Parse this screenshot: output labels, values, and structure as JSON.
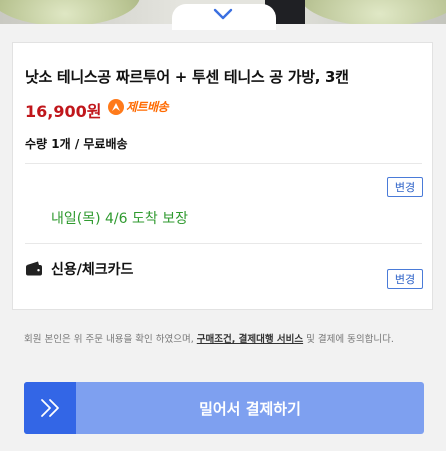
{
  "product": {
    "title": "낫소 테니스공 짜르투어 + 투센 테니스 공 가방, 3캔",
    "price": "16,900원",
    "rocket_label": "제트배송",
    "quantity_shipping": "수량 1개 / 무료배송"
  },
  "delivery": {
    "change_label": "변경",
    "arrival_text": "내일(목) 4/6 도착 보장"
  },
  "payment": {
    "method": "신용/체크카드",
    "change_label": "변경"
  },
  "notice": {
    "prefix": "회원 본인은 위 주문 내용을 확인 하였으며, ",
    "link_text": "구매조건, 결제대행 서비스",
    "suffix": " 및 결제에 동의합니다."
  },
  "pay_button": {
    "label": "밀어서 결제하기"
  },
  "colors": {
    "price": "#c0161b",
    "rocket": "#ff6a00",
    "arrival": "#2f9a2f",
    "button": "#7ea0f0",
    "button_accent": "#3366e6"
  },
  "icons": [
    "chevron-down-icon",
    "rocket-icon",
    "wallet-icon",
    "double-chevron-right-icon"
  ]
}
